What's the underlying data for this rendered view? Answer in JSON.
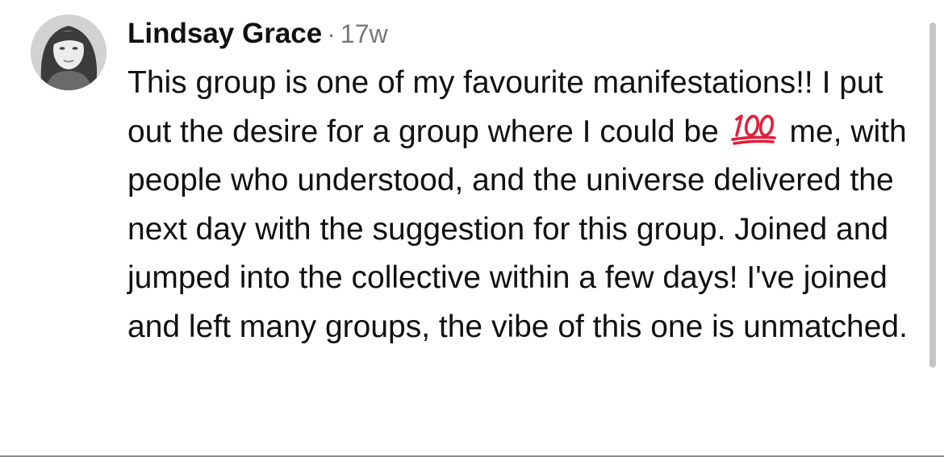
{
  "comment": {
    "author": "Lindsay Grace",
    "separator": "·",
    "time_ago": "17w",
    "avatar_icon": "profile-photo",
    "text_before_emoji": "This group is one of my favourite manifestations!! I put out the desire for a group where I could be",
    "emoji": "hundred-points-emoji",
    "text_after_emoji": "me, with people who understood, and the universe delivered the next day with the suggestion for this group. Joined and jumped into the collective within a few days! I've joined and left many groups, the vibe of this one is unmatched."
  },
  "colors": {
    "text": "#111111",
    "meta": "#777777",
    "emoji_red": "#e0203a",
    "divider": "#8a8a8a"
  }
}
